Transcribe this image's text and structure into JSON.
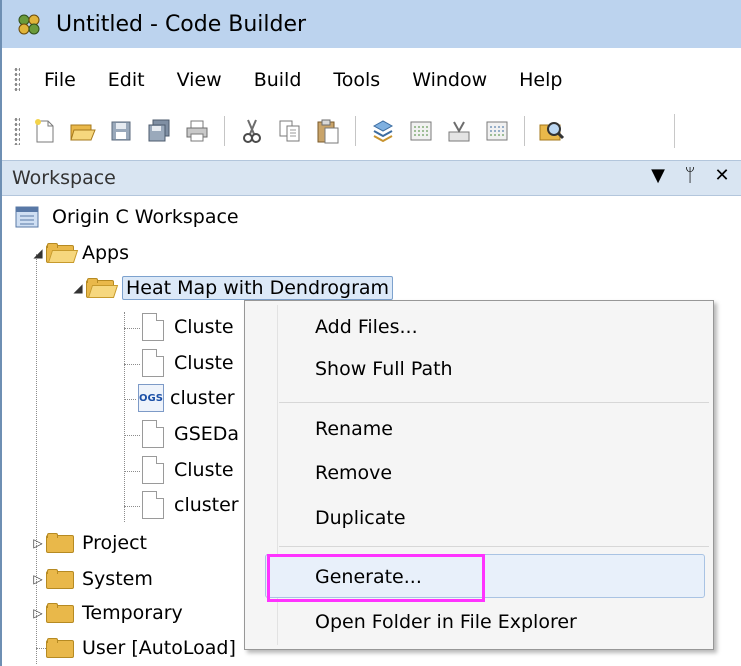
{
  "window": {
    "title": "Untitled - Code Builder",
    "icon": "code-builder-icon"
  },
  "menubar": {
    "items": [
      "File",
      "Edit",
      "View",
      "Build",
      "Tools",
      "Window",
      "Help"
    ]
  },
  "toolbar": {
    "buttons": [
      "new-file-icon",
      "open-folder-icon",
      "save-icon",
      "save-all-icon",
      "print-icon",
      "cut-icon",
      "copy-icon",
      "paste-icon",
      "build-icon",
      "compile-icon",
      "debug-icon",
      "build-all-icon",
      "find-icon"
    ]
  },
  "workspace": {
    "title": "Workspace",
    "controls": [
      "▼",
      "ᛘ",
      "✕"
    ],
    "root": "Origin C Workspace",
    "apps_label": "Apps",
    "selected_folder": "Heat Map with Dendrogram",
    "files": [
      "Cluste",
      "Cluste",
      "cluster",
      "GSEDa",
      "Cluste",
      "cluster"
    ],
    "folders": [
      "Project",
      "System",
      "Temporary",
      "User [AutoLoad]"
    ]
  },
  "context_menu": {
    "items": [
      "Add Files...",
      "Show Full Path",
      "Rename",
      "Remove",
      "Duplicate",
      "Generate...",
      "Open Folder in File Explorer"
    ],
    "highlighted": "Generate...",
    "highlight_color": "#ff33ff"
  },
  "colors": {
    "titlebar": "#bcd3ee",
    "panel_header": "#d9e5f2",
    "folder": "#f6d77e",
    "highlight_box": "#ff33ff"
  }
}
